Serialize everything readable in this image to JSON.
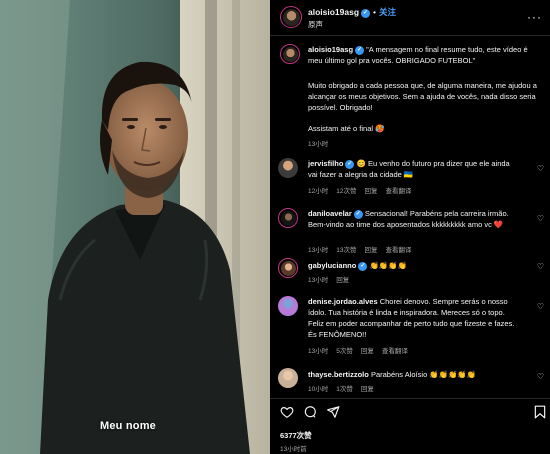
{
  "video": {
    "caption": "Meu nome"
  },
  "header": {
    "username": "aloisio19asg",
    "dot": "•",
    "follow_label": "关注",
    "subtitle": "原声",
    "more_icon": "more-horizontal-icon"
  },
  "post": {
    "username": "aloisio19asg",
    "lines": [
      "\"A mensagem no final resume tudo, este vídeo é meu último gol pra vocês. OBRIGADO FUTEBOL\"",
      "",
      "Muito obrigado a cada pessoa que, de alguma maneira, me ajudou a alcançar os meus objetivos. Sem a ajuda de vocês, nada disso seria possível. Obrigado!",
      "",
      "Assistam até o final 🥵"
    ],
    "time": "13小时"
  },
  "comments": [
    {
      "username": "jervisfilho",
      "verified": true,
      "text": "😊 Eu venho do futuro pra dizer que ele ainda vai fazer a alegria da cidade 🇺🇦",
      "time": "12小时",
      "likes": "12次赞",
      "reply": "回复",
      "translate": "查看翻译"
    },
    {
      "username": "daniloavelar",
      "verified": true,
      "text": "Sensacional! Parabéns pela carreira irmão. Bem-vindo ao time dos aposentados kkkkkkkkk amo vc ❤️",
      "time": "13小时",
      "likes": "13次赞",
      "reply": "回复",
      "translate": "查看翻译"
    },
    {
      "username": "gabylucianno",
      "verified": true,
      "text": "👏👏👏👏",
      "time": "13小时",
      "likes": "",
      "reply": "回复",
      "translate": ""
    },
    {
      "username": "denise.jordao.alves",
      "verified": false,
      "text": "Chorei denovo. Sempre serás o nosso ídolo. Tua história é linda e inspiradora. Mereces só o topo. Feliz em poder acompanhar de perto tudo que fizeste e fazes. És FENÔMENO!!",
      "time": "13小时",
      "likes": "5次赞",
      "reply": "回复",
      "translate": "查看翻译"
    },
    {
      "username": "thayse.bertizzolo",
      "verified": false,
      "text": "Parabéns Aloísio 👏👏👏👏👏",
      "time": "10小时",
      "likes": "1次赞",
      "reply": "回复",
      "translate": ""
    }
  ],
  "footer": {
    "likes": "6377次赞",
    "time": "13小时前"
  },
  "colors": {
    "link": "#4aa3ff",
    "verified": "#3897f0",
    "muted": "#a8a8a8"
  }
}
